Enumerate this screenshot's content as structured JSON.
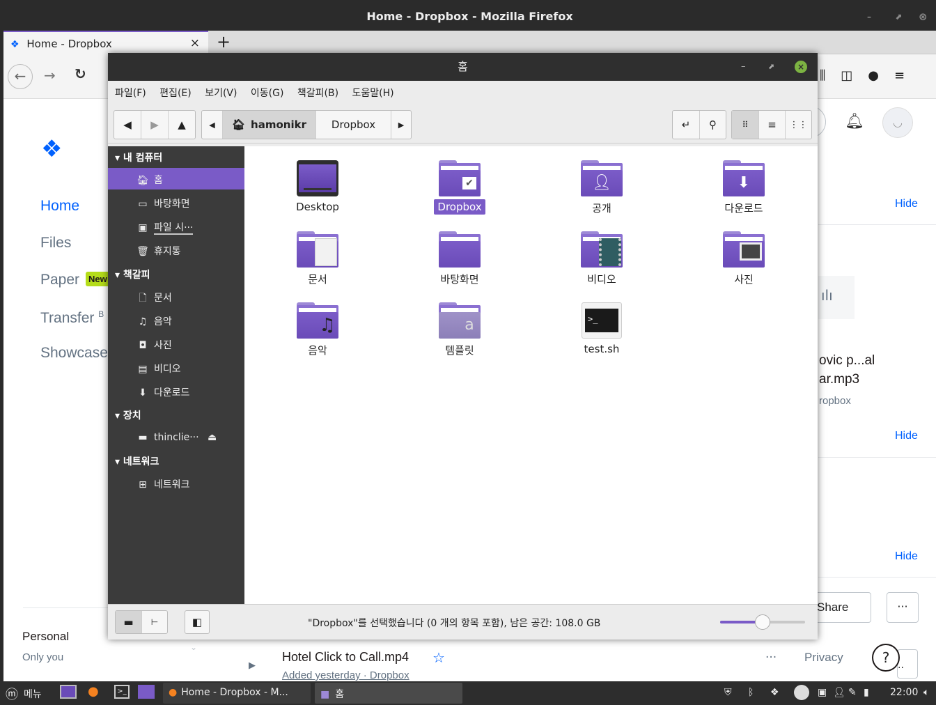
{
  "firefox": {
    "window_title": "Home - Dropbox - Mozilla Firefox",
    "tab_title": "Home - Dropbox",
    "new_tab": "+",
    "tab_close": "×"
  },
  "dropbox": {
    "nav": [
      "Home",
      "Files",
      "Paper",
      "Transfer",
      "Showcase"
    ],
    "paper_badge": "New",
    "transfer_suffix": "B",
    "hide": "Hide",
    "file_name_line1": "ovic p...al",
    "file_name_line2": "ar.mp3",
    "file_location": "ropbox",
    "share": "Share",
    "more": "···",
    "personal": "Personal",
    "only_you": "Only you",
    "recent_file": "Hotel Click to Call.mp4",
    "recent_sub": "Added yesterday · Dropbox",
    "privacy": "Privacy",
    "help": "?"
  },
  "file_manager": {
    "title": "홈",
    "menu": [
      "파일(F)",
      "편집(E)",
      "보기(V)",
      "이동(G)",
      "책갈피(B)",
      "도움말(H)"
    ],
    "path": [
      "hamonikr",
      "Dropbox"
    ],
    "sidebar": {
      "computer_header": "내 컴퓨터",
      "computer_items": [
        "홈",
        "바탕화면",
        "파일 시···",
        "휴지통"
      ],
      "bookmarks_header": "책갈피",
      "bookmark_items": [
        "문서",
        "음악",
        "사진",
        "비디오",
        "다운로드"
      ],
      "devices_header": "장치",
      "device_items": [
        "thinclie···"
      ],
      "network_header": "네트워크",
      "network_items": [
        "네트워크"
      ]
    },
    "items": [
      {
        "label": "Desktop",
        "icon": "desktop-folder-icon"
      },
      {
        "label": "Dropbox",
        "icon": "dropbox-folder-icon",
        "selected": true
      },
      {
        "label": "공개",
        "icon": "public-folder-icon"
      },
      {
        "label": "다운로드",
        "icon": "download-folder-icon"
      },
      {
        "label": "문서",
        "icon": "documents-folder-icon"
      },
      {
        "label": "바탕화면",
        "icon": "folder-icon"
      },
      {
        "label": "비디오",
        "icon": "videos-folder-icon"
      },
      {
        "label": "사진",
        "icon": "pictures-folder-icon"
      },
      {
        "label": "음악",
        "icon": "music-folder-icon"
      },
      {
        "label": "템플릿",
        "icon": "templates-folder-icon"
      },
      {
        "label": "test.sh",
        "icon": "terminal-script-icon"
      }
    ],
    "status": "\"Dropbox\"를 선택했습니다 (0 개의 항목 포함), 남은 공간: 108.0 GB",
    "zoom_fraction": 0.5
  },
  "taskbar": {
    "menu": "메뉴",
    "task_firefox": "Home - Dropbox - M...",
    "task_files": "홈",
    "clock": "22:00"
  },
  "colors": {
    "accent": "#7a5bc7",
    "dropbox_blue": "#0061fe"
  }
}
